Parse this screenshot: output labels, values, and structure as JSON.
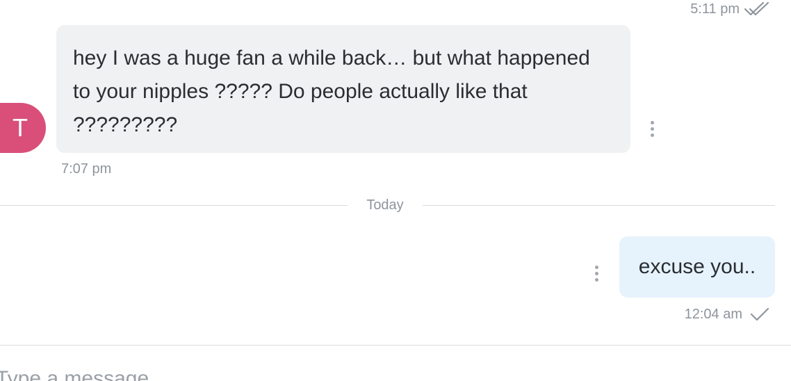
{
  "top_message": {
    "time": "5:11 pm",
    "status_icon": "double-check-icon"
  },
  "incoming_message": {
    "avatar_letter": "T",
    "avatar_color": "#d94f7a",
    "lines": [
      "hey I was a huge fan a while back… but what happened",
      "to your nipples ????? Do people actually like that",
      "?????????"
    ],
    "time": "7:07 pm"
  },
  "date_divider": {
    "label": "Today"
  },
  "outgoing_message": {
    "text": "excuse you..",
    "time": "12:04 am",
    "status_icon": "single-check-icon"
  },
  "composer": {
    "placeholder": "Type a message"
  },
  "colors": {
    "incoming_bubble": "#f0f1f3",
    "outgoing_bubble": "#e6f3fd",
    "muted_text": "#8e949c"
  }
}
